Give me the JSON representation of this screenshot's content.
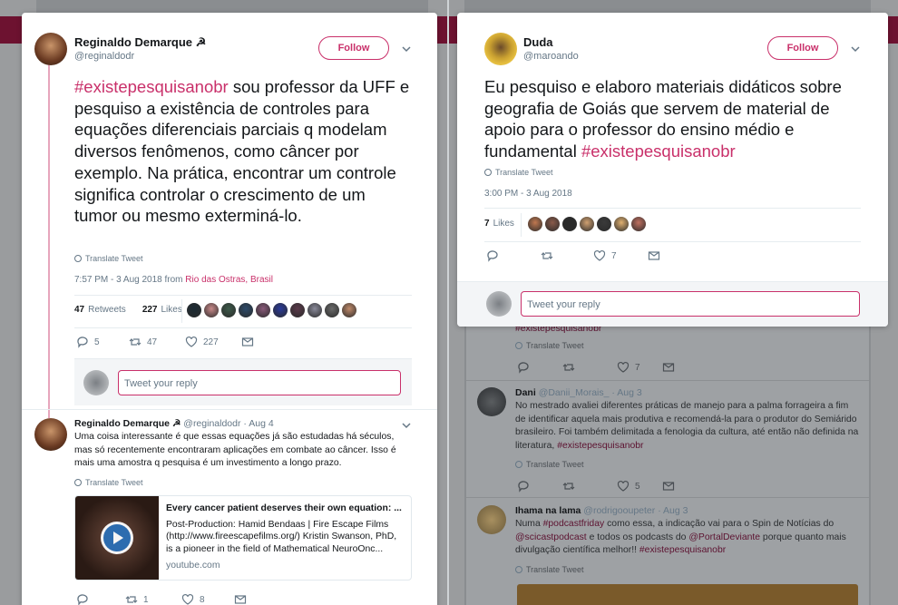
{
  "left_tweet": {
    "author_name": "Reginaldo Demarque ☭",
    "author_handle": "@reginaldodr",
    "follow_label": "Follow",
    "text_hashtag": "#existepesquisanobr",
    "text_body": " sou professor da UFF e pesquiso a existência de controles para equações diferenciais parciais q modelam diversos fenômenos, como câncer por exemplo. Na prática, encontrar um controle significa controlar o crescimento de um tumor ou mesmo exterminá-lo.",
    "translate_label": "Translate Tweet",
    "timestamp": "7:57 PM - 3 Aug 2018 from ",
    "location": "Rio das Ostras, Brasil",
    "retweets_count": "47",
    "retweets_label": "Retweets",
    "likes_count": "227",
    "likes_label": "Likes",
    "reply_count": "5",
    "retweet_action_count": "47",
    "like_action_count": "227",
    "reply_placeholder": "Tweet your reply",
    "liker_colors": [
      "#1b2a33",
      "#c98a8a",
      "#3d5a4a",
      "#2c4a6a",
      "#8a5a7a",
      "#2a3a9a",
      "#5a3a4a",
      "#8a8a9a",
      "#6a6a6a",
      "#c08a6a"
    ]
  },
  "left_reply": {
    "author_name": "Reginaldo Demarque ☭",
    "author_handle": "@reginaldodr",
    "date": "· Aug 4",
    "text": "Uma coisa interessante é que essas equações já são estudadas há séculos, mas só recentemente encontraram aplicações em combate ao câncer. Isso é mais uma amostra q pesquisa é um investimento a longo prazo.",
    "translate_label": "Translate Tweet",
    "card_title": "Every cancer patient deserves their own equation: ...",
    "card_desc": "Post-Production: Hamid Bendaas | Fire Escape Films (http://www.fireescapefilms.org/) Kristin Swanson, PhD, is a pioneer in the field of Mathematical NeuroOnc...",
    "card_domain": "youtube.com",
    "reply_count": "",
    "retweet_count": "1",
    "like_count": "8"
  },
  "right_tweet": {
    "author_name": "Duda",
    "author_handle": "@maroando",
    "follow_label": "Follow",
    "text_body": "Eu pesquiso e elaboro materiais didáticos sobre geografia de Goiás que servem de material de apoio para o professor do ensino médio e fundamental ",
    "text_hashtag": "#existepesquisanobr",
    "translate_label": "Translate Tweet",
    "timestamp": "3:00 PM - 3 Aug 2018",
    "likes_count": "7",
    "likes_label": "Likes",
    "like_action_count": "7",
    "reply_placeholder": "Tweet your reply",
    "liker_colors": [
      "#c07850",
      "#8a5a4a",
      "#2a2a2a",
      "#d0a070",
      "#3a3a3a",
      "#e0b070",
      "#c07060"
    ]
  },
  "bg_timeline": {
    "partial_hashtag": "#existepesquisanobr",
    "translate_label_1": "Translate Tweet",
    "like_count_1": "7",
    "tweet2_name": "Dani",
    "tweet2_handle": "@Danii_Morais_",
    "tweet2_date": "· Aug 3",
    "tweet2_text": "No mestrado avaliei diferentes práticas de manejo para a palma forrageira a fim de identificar aquela mais produtiva e recomendá-la para o produtor do Semiárido brasileiro. Foi também delimitada a fenologia da cultura, até então não definida na literatura, ",
    "tweet2_hashtag": "#existepesquisanobr",
    "translate_label_2": "Translate Tweet",
    "like_count_2": "5",
    "tweet3_name": "Ihama na lama",
    "tweet3_handle": "@rodrigooupeter",
    "tweet3_date": "· Aug 3",
    "tweet3_text_a": "Numa ",
    "tweet3_hashtag_a": "#podcastfriday",
    "tweet3_text_b": " como essa, a indicação vai para o Spin de Notícias do ",
    "tweet3_mention_a": "@scicastpodcast",
    "tweet3_text_c": " e todos os podcasts do ",
    "tweet3_mention_b": "@PortalDeviante",
    "tweet3_text_d": " porque quanto mais divulgação científica melhor!! ",
    "tweet3_hashtag_b": "#existepesquisanobr",
    "translate_label_3": "Translate Tweet"
  }
}
